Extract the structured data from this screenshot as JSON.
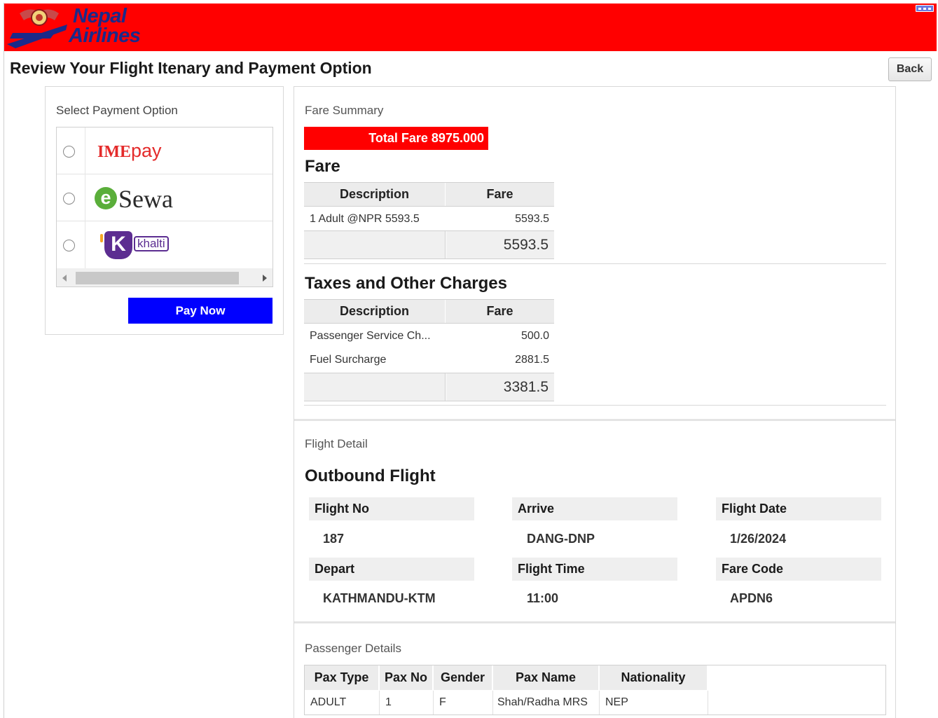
{
  "header": {
    "brand_line1": "Nepal",
    "brand_line2": "Airlines",
    "brand_color": "#ff0000",
    "menu_icon": "window-controls-icon"
  },
  "page": {
    "title": "Review Your Flight Itenary and Payment Option",
    "back_label": "Back"
  },
  "payment": {
    "label": "Select Payment Option",
    "options": [
      {
        "name": "IMEpay",
        "brand_part1": "IME",
        "brand_part2": "pay",
        "color": "#e42b2b"
      },
      {
        "name": "eSewa",
        "brand_part1": "e",
        "brand_part2": "Sewa",
        "color": "#5aae3a"
      },
      {
        "name": "khalti",
        "brand_part1": "K",
        "brand_part2": "khalti",
        "color": "#5c2d91"
      }
    ],
    "pay_now_label": "Pay Now",
    "pay_now_color": "#0000ff"
  },
  "fare_summary": {
    "label": "Fare Summary",
    "total_fare": "Total Fare 8975.000",
    "fare_heading": "Fare",
    "columns": [
      "Description",
      "Fare"
    ],
    "fare_rows": [
      {
        "description": "1 Adult @NPR 5593.5",
        "fare": "5593.5"
      }
    ],
    "fare_total": "5593.5",
    "taxes_heading": "Taxes and Other Charges",
    "tax_rows": [
      {
        "description": "Passenger Service Ch...",
        "fare": "500.0"
      },
      {
        "description": "Fuel Surcharge",
        "fare": "2881.5"
      }
    ],
    "tax_total": "3381.5"
  },
  "flight_detail": {
    "label": "Flight Detail",
    "heading": "Outbound Flight",
    "fields": {
      "flight_no_label": "Flight No",
      "flight_no": "187",
      "arrive_label": "Arrive",
      "arrive": "DANG-DNP",
      "flight_date_label": "Flight Date",
      "flight_date": "1/26/2024",
      "depart_label": "Depart",
      "depart": "KATHMANDU-KTM",
      "flight_time_label": "Flight Time",
      "flight_time": "11:00",
      "fare_code_label": "Fare Code",
      "fare_code": "APDN6"
    }
  },
  "passenger_details": {
    "label": "Passenger Details",
    "columns": [
      "Pax Type",
      "Pax No",
      "Gender",
      "Pax Name",
      "Nationality"
    ],
    "rows": [
      [
        "ADULT",
        "1",
        "F",
        "Shah/Radha MRS",
        "NEP"
      ]
    ]
  }
}
